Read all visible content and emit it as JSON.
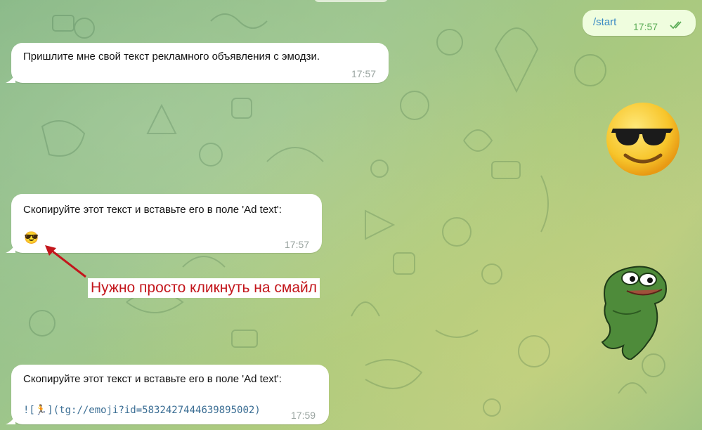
{
  "messages": [
    {
      "id": "m1",
      "direction": "out",
      "text": "/start",
      "time": "17:57",
      "status_icon": "double-check-icon"
    },
    {
      "id": "m2",
      "direction": "in",
      "text": "Пришлите мне свой текст рекламного объявления с эмодзи.",
      "time": "17:57"
    },
    {
      "id": "m3",
      "direction": "in",
      "text": "Скопируйте этот текст и вставьте его в поле 'Ad text':",
      "emoji": "😎",
      "time": "17:57"
    },
    {
      "id": "m4",
      "direction": "in",
      "text": "Скопируйте этот текст и вставьте его в поле 'Ad text':",
      "code_prefix": "![",
      "code_emoji": "🏃",
      "code_suffix": "](tg://emoji?id=5832427444639895002)",
      "time": "17:59"
    }
  ],
  "stickers": [
    {
      "name": "sunglasses-smiley-sticker"
    },
    {
      "name": "pepe-frog-sticker"
    }
  ],
  "annotation": {
    "text": "Нужно просто кликнуть на смайл",
    "color": "#c3161c"
  },
  "colors": {
    "incoming_bubble": "#ffffff",
    "outgoing_bubble": "#effdde",
    "outgoing_time": "#5fae5a"
  }
}
